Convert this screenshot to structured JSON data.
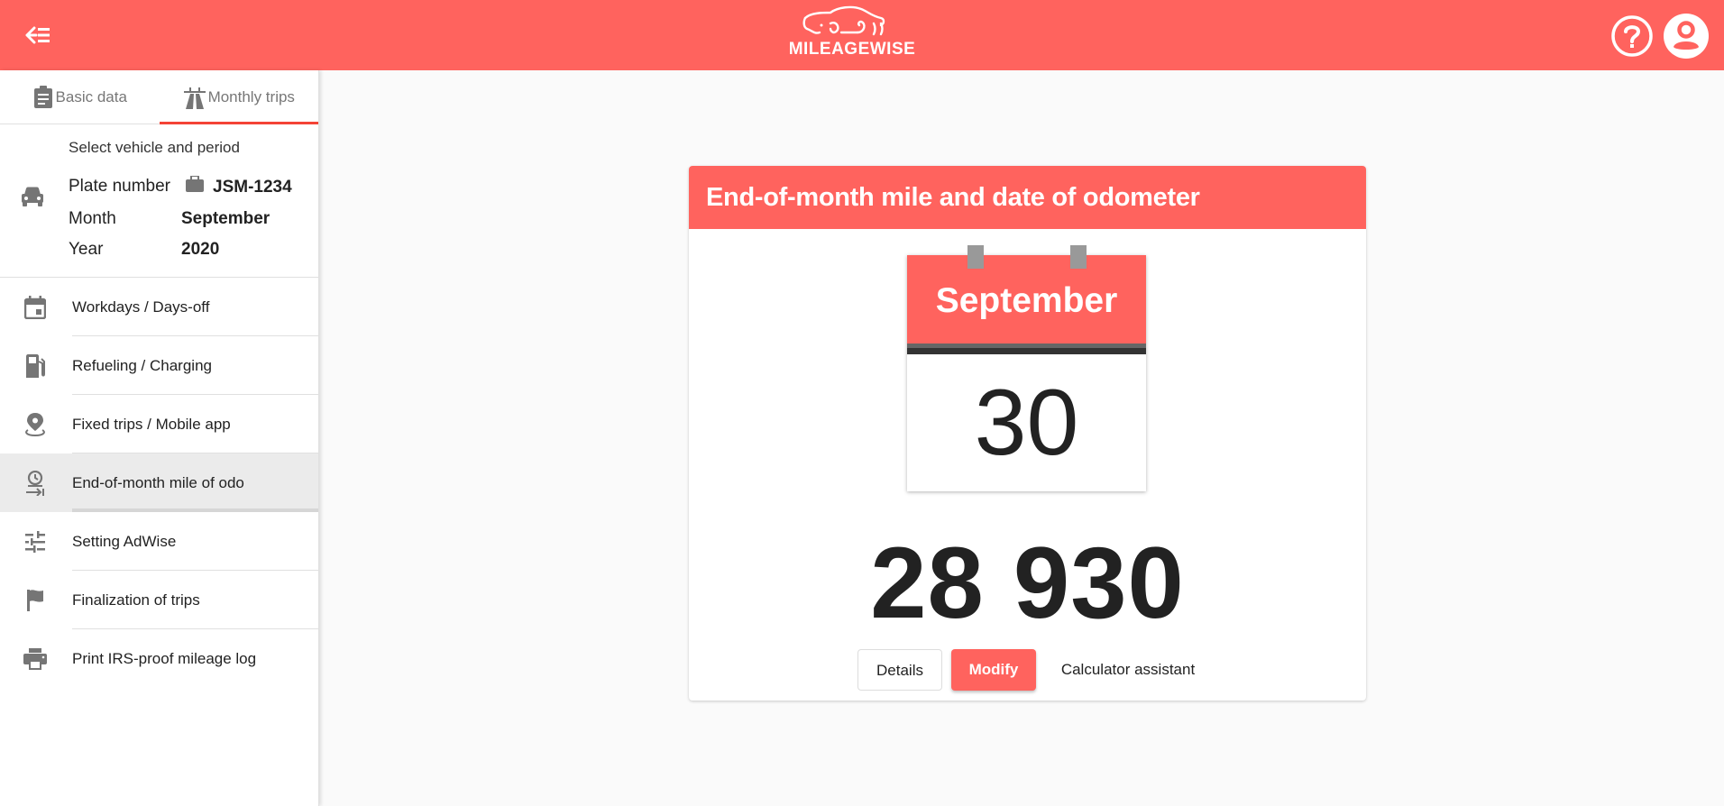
{
  "topbar": {
    "menu_icon": "menu-open-icon",
    "logo_text": "MILEAGEWISE",
    "help_icon": "help-circle-icon",
    "account_icon": "account-circle-icon",
    "accent_color": "#ff635e"
  },
  "sidebar": {
    "tabs": [
      {
        "label": "Basic data",
        "icon": "clipboard-icon",
        "active": false
      },
      {
        "label": "Monthly trips",
        "icon": "highway-icon",
        "active": true
      }
    ],
    "vehicle": {
      "heading": "Select vehicle and period",
      "plate_label": "Plate number",
      "plate_value": "JSM-1234",
      "month_label": "Month",
      "month_value": "September",
      "year_label": "Year",
      "year_value": "2020"
    },
    "items": [
      {
        "label": "Workdays / Days-off",
        "icon": "calendar-icon"
      },
      {
        "label": "Refueling / Charging",
        "icon": "fuel-pump-icon"
      },
      {
        "label": "Fixed trips / Mobile app",
        "icon": "map-pin-icon"
      },
      {
        "label": "End-of-month mile of odo",
        "icon": "clock-arrow-icon",
        "active": true
      },
      {
        "label": "Setting AdWise",
        "icon": "sliders-icon"
      },
      {
        "label": "Finalization of trips",
        "icon": "flag-icon"
      },
      {
        "label": "Print IRS-proof mileage log",
        "icon": "printer-icon"
      }
    ]
  },
  "card": {
    "title": "End-of-month mile and date of odometer",
    "calendar_month": "September",
    "calendar_day": "30",
    "odometer_value": "28 930",
    "buttons": {
      "details": "Details",
      "modify": "Modify",
      "calculator": "Calculator assistant"
    }
  }
}
